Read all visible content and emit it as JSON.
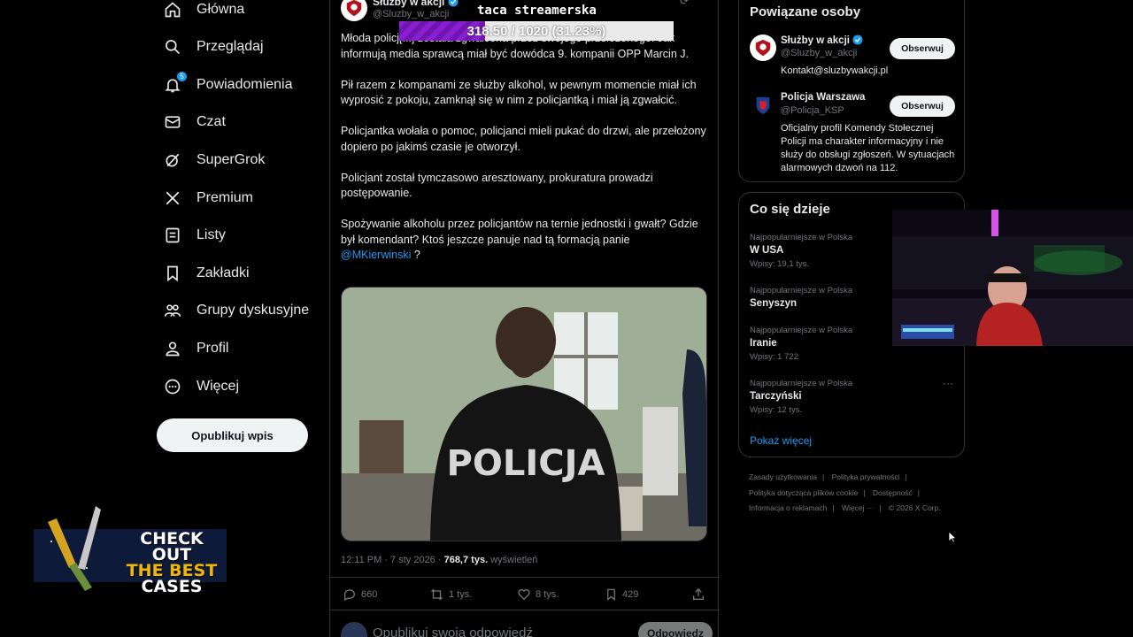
{
  "sidebar": {
    "items": [
      {
        "label": "Główna",
        "icon": "home-icon"
      },
      {
        "label": "Przeglądaj",
        "icon": "search-icon"
      },
      {
        "label": "Powiadomienia",
        "icon": "bell-icon",
        "badge": "5"
      },
      {
        "label": "Czat",
        "icon": "mail-icon"
      },
      {
        "label": "SuperGrok",
        "icon": "grok-icon"
      },
      {
        "label": "Premium",
        "icon": "x-logo-icon"
      },
      {
        "label": "Listy",
        "icon": "list-icon"
      },
      {
        "label": "Zakładki",
        "icon": "bookmark-icon"
      },
      {
        "label": "Grupy dyskusyjne",
        "icon": "community-icon"
      },
      {
        "label": "Profil",
        "icon": "person-icon"
      },
      {
        "label": "Więcej",
        "icon": "more-circle-icon"
      }
    ],
    "post_button": "Opublikuj wpis"
  },
  "tweet": {
    "author_name": "Służby w akcji",
    "author_handle": "@Sluzby_w_akcji",
    "paragraphs": [
      "Młoda policj[...] została zgwałcona przez swojego przełożonego. Jak informują media sprawcą miał być dowódca 9. kompanii OPP Marcin J.",
      "Pił razem z kompanami ze służby alkohol, w pewnym momencie miał ich wyprosić z pokoju, zamknął się w nim z policjantką i miał ją zgwałcić.",
      "Policjantka wołała o pomoc, policjanci mieli pukać do drzwi, ale przełożony dopiero po jakimś czasie je otworzył.",
      "Policjant został tymczasowo aresztowany, prokuratura prowadzi postępowanie.",
      "Spożywanie alkoholu przez policjantów na ternie jednostki i gwałt? Gdzie był komendant? Ktoś jeszcze panuje nad tą formacją panie"
    ],
    "mention": "@MKierwinski",
    "mention_suffix": " ?",
    "image_text": "POLICJA",
    "time": "12:11 PM · 7 sty 2026 · ",
    "views": "768,7 tys.",
    "views_label": " wyświetleń",
    "replies": "660",
    "reposts": "1 tys.",
    "likes": "8 tys.",
    "bookmarks": "429",
    "reply_placeholder": "Opublikuj swoją odpowiedź",
    "reply_button": "Odpowiedz"
  },
  "overlay": {
    "goal_title": "taca streamerska",
    "goal_text": "318.50 / 1020 (31.23%)",
    "goal_fraction": 0.3123,
    "promo_line1": "CHECK OUT",
    "promo_line2": "THE BEST",
    "promo_line3": "CASES"
  },
  "related": {
    "title": "Powiązane osoby",
    "people": [
      {
        "name": "Służby w akcji",
        "handle": "@Sluzby_w_akcji",
        "bio": "Kontakt@sluzbywakcji.pl",
        "button": "Obserwuj"
      },
      {
        "name": "Policja Warszawa",
        "handle": "@Policja_KSP",
        "bio": "Oficjalny profil Komendy Stołecznej Policji ma charakter informacyjny i nie służy do obsługi zgłoszeń. W sytuacjach alarmowych dzwoń na 112.",
        "button": "Obserwuj"
      }
    ]
  },
  "trends": {
    "title": "Co się dzieje",
    "items": [
      {
        "category": "Najpopularniejsze w Polska",
        "name": "W USA",
        "count": "Wpisy: 19,1 tys."
      },
      {
        "category": "Najpopularniejsze w Polska",
        "name": "Senyszyn",
        "count": ""
      },
      {
        "category": "Najpopularniejsze w Polska",
        "name": "Iranie",
        "count": "Wpisy: 1 722"
      },
      {
        "category": "Najpopularniejsze w Polska",
        "name": "Tarczyński",
        "count": "Wpisy: 12 tys."
      }
    ],
    "show_more": "Pokaż więcej"
  },
  "footer": {
    "links": [
      "Zasady użytkowania",
      "Polityka prywatności",
      "Polityka dotycząca plików cookie",
      "Dostępność",
      "Informacja o reklamach",
      "Więcej ···",
      "© 2026 X Corp."
    ]
  },
  "colors": {
    "background": "#000000",
    "accent": "#1d9bf0",
    "goal_fill": "#8a1fd1",
    "border": "#2f3336"
  }
}
